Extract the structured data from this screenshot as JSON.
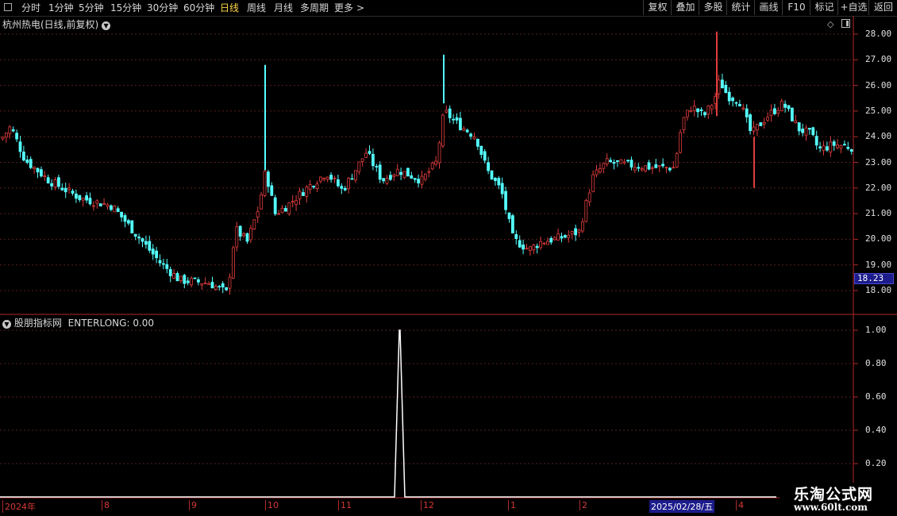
{
  "toolbar": {
    "left_tabs": [
      "分时",
      "1分钟",
      "5分钟",
      "15分钟",
      "30分钟",
      "60分钟",
      "日线",
      "周线",
      "月线",
      "多周期",
      "更多"
    ],
    "active_tab": "日线",
    "more_arrow": ">",
    "right_buttons": [
      "复权",
      "叠加",
      "多股",
      "统计",
      "画线",
      "F10",
      "标记",
      "+自选",
      "返回"
    ]
  },
  "main_panel": {
    "title": "杭州热电(日线,前复权)",
    "price_axis": [
      "28.00",
      "27.00",
      "26.00",
      "25.00",
      "24.00",
      "23.00",
      "22.00",
      "21.00",
      "20.00",
      "19.00",
      "18.00"
    ],
    "current_price": "18.23",
    "up_color": "#e03c3c",
    "down_color": "#54ffff"
  },
  "indicator_panel": {
    "title": "股朋指标网",
    "indicator_label": "ENTERLONG: 0.00",
    "axis": [
      "1.00",
      "0.80",
      "0.60",
      "0.40",
      "0.20"
    ]
  },
  "date_axis": {
    "labels": [
      "2024年",
      "8",
      "9",
      "10",
      "11",
      "12",
      "1",
      "2",
      "2025/02/28/五",
      "4"
    ]
  },
  "watermark": {
    "line1": "乐淘公式网",
    "line2": "www.60lt.com"
  }
}
